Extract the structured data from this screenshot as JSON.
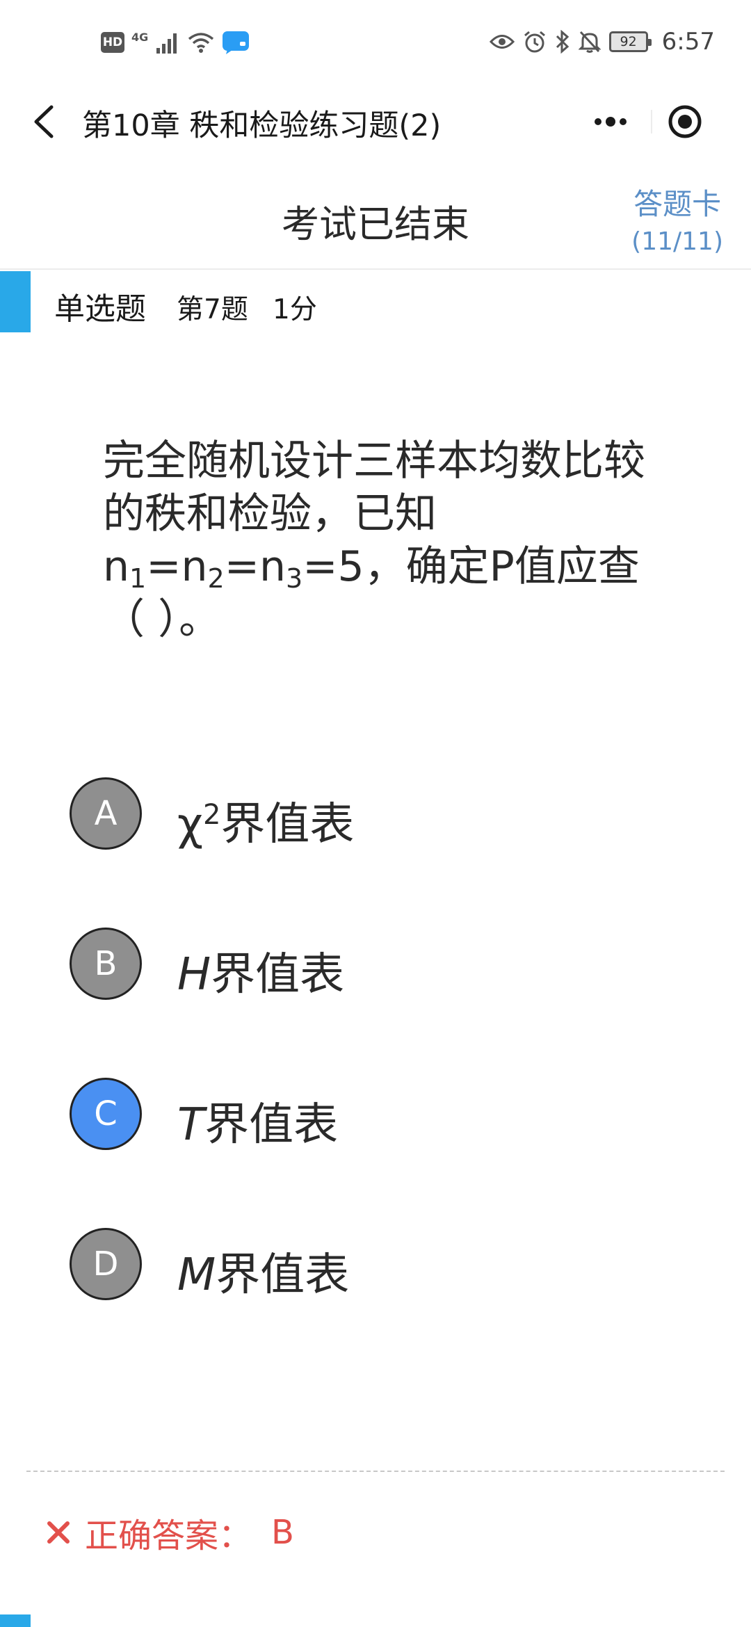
{
  "status_bar": {
    "hd": "HD",
    "network": "4G",
    "battery": "92",
    "time": "6:57",
    "icons": [
      "signal-icon",
      "wifi-icon",
      "chat-app-icon",
      "eye-icon",
      "alarm-icon",
      "bluetooth-icon",
      "mute-icon",
      "battery-icon"
    ]
  },
  "nav": {
    "title": "第10章 秩和检验练习题(2)",
    "icons": [
      "back-icon",
      "more-icon",
      "close-target-icon"
    ]
  },
  "exam": {
    "status": "考试已结束",
    "answer_card_title": "答题卡",
    "answer_card_count": "(11/11)"
  },
  "question": {
    "type": "单选题",
    "number": "第7题",
    "score": "1分",
    "text_part1": "完全随机设计三样本均数比较的秩和检验，已知",
    "n": "n",
    "sub1": "1",
    "sub2": "2",
    "sub3": "3",
    "eq": "=",
    "five": "5",
    "text_part2": "，确定P值应查（ ）。"
  },
  "options": [
    {
      "letter": "A",
      "prefix": "χ",
      "sup": "2",
      "suffix": "界值表",
      "selected": false
    },
    {
      "letter": "B",
      "prefix": "H",
      "suffix": "界值表",
      "selected": false
    },
    {
      "letter": "C",
      "prefix": "T",
      "suffix": "界值表",
      "selected": true
    },
    {
      "letter": "D",
      "prefix": "M",
      "suffix": "界值表",
      "selected": false
    }
  ],
  "result": {
    "label": "正确答案：",
    "value": "B",
    "icon": "x-icon"
  },
  "colors": {
    "accent_blue": "#29a8e8",
    "selected_option": "#4a90f2",
    "unselected_option": "#8f8f8f",
    "link_blue": "#5b8fc7",
    "error_red": "#e2504b"
  }
}
